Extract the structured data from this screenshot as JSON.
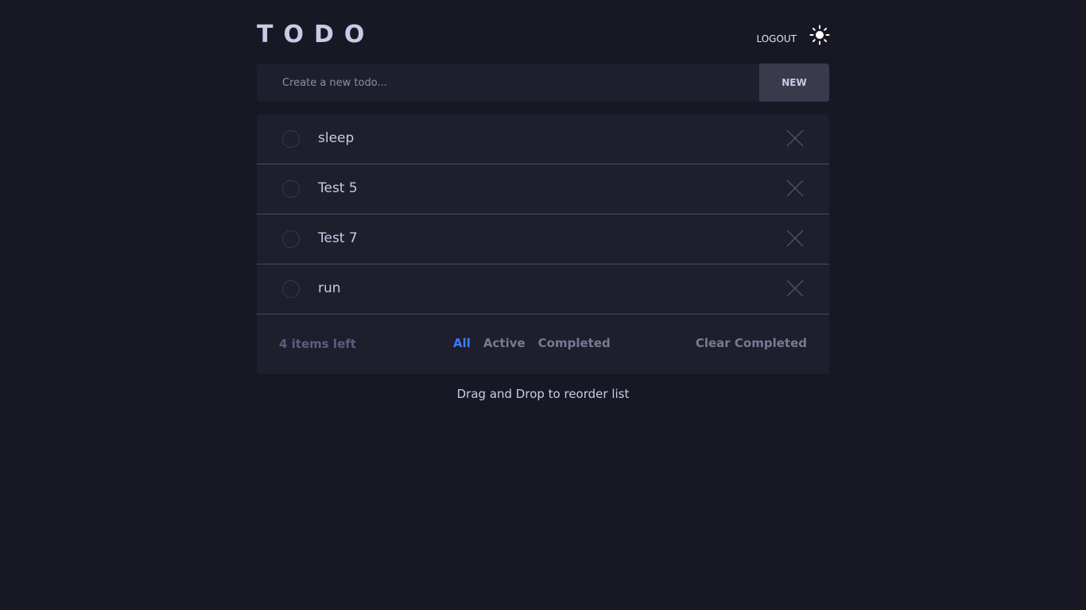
{
  "header": {
    "title": "TODO",
    "logout_label": "LOGOUT",
    "theme_icon": "sun-icon"
  },
  "new_todo": {
    "placeholder": "Create a new todo...",
    "button_label": "NEW"
  },
  "todos": [
    {
      "text": "sleep",
      "completed": false
    },
    {
      "text": "Test 5",
      "completed": false
    },
    {
      "text": "Test 7",
      "completed": false
    },
    {
      "text": "run",
      "completed": false
    }
  ],
  "footer": {
    "items_left": "4 items left",
    "filters": [
      {
        "label": "All",
        "active": true
      },
      {
        "label": "Active",
        "active": false
      },
      {
        "label": "Completed",
        "active": false
      }
    ],
    "clear_label": "Clear Completed"
  },
  "hint": "Drag and Drop to reorder list",
  "colors": {
    "background": "#181824",
    "card": "#1e1e2c",
    "accent": "#3a7cfd",
    "text": "#c8cbe7",
    "muted": "#777a92"
  }
}
